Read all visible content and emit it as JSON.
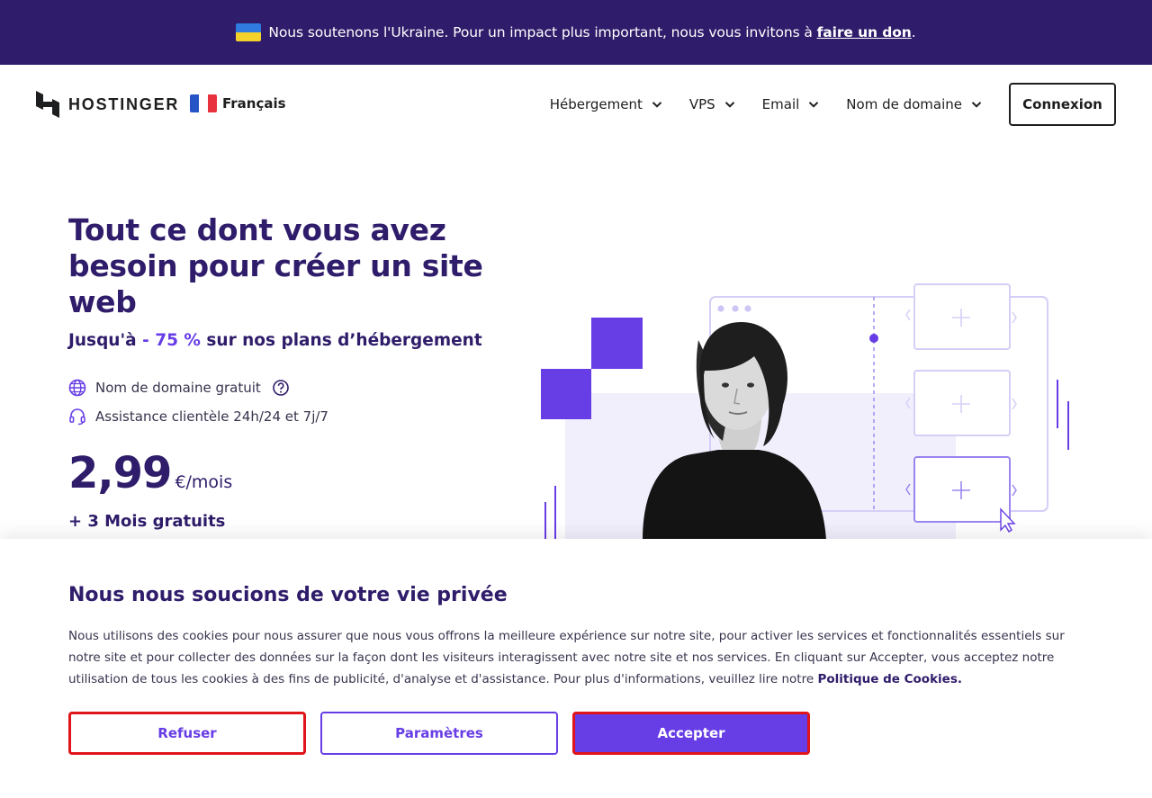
{
  "banner": {
    "text": "Nous soutenons l'Ukraine. Pour un impact plus important, nous vous invitons à",
    "link": "faire un don",
    "end": "."
  },
  "header": {
    "brand": "HOSTINGER",
    "language": "Français",
    "nav": [
      {
        "label": "Hébergement"
      },
      {
        "label": "VPS"
      },
      {
        "label": "Email"
      },
      {
        "label": "Nom de domaine"
      }
    ],
    "login": "Connexion"
  },
  "hero": {
    "title": "Tout ce dont vous avez besoin pour créer un site web",
    "sub_prefix": "Jusqu'à",
    "sub_accent": "- 75 %",
    "sub_suffix": "sur nos plans d’hébergement",
    "features": [
      "Nom de domaine gratuit",
      "Assistance clientèle 24h/24 et 7j/7"
    ],
    "price": "2,99",
    "price_unit": "€/mois",
    "bonus": "+ 3 Mois gratuits"
  },
  "cookie": {
    "title": "Nous nous soucions de votre vie privée",
    "text": "Nous utilisons des cookies pour nous assurer que nous vous offrons la meilleure expérience sur notre site, pour activer les services et fonctionnalités essentiels sur notre site et pour collecter des données sur la façon dont les visiteurs interagissent avec notre site et nos services. En cliquant sur Accepter, vous acceptez notre utilisation de tous les cookies à des fins de publicité, d'analyse et d'assistance. Pour plus d'informations, veuillez lire notre",
    "policy_link": "Politique de Cookies.",
    "refuse": "Refuser",
    "settings": "Paramètres",
    "accept": "Accepter"
  },
  "colors": {
    "brand_dark": "#2f1c6a",
    "brand_purple": "#673de6",
    "highlight_red": "#e0141b"
  }
}
